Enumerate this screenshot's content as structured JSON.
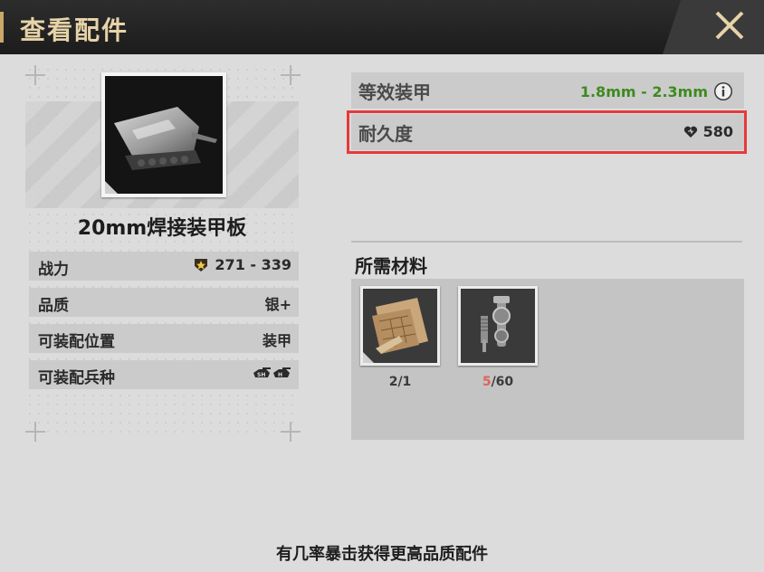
{
  "header": {
    "title": "查看配件",
    "close_icon": "close-x-icon"
  },
  "item": {
    "name": "20mm焊接装甲板"
  },
  "stats": [
    {
      "label": "战力",
      "value": "271 - 339",
      "icon": "power-star-icon"
    },
    {
      "label": "品质",
      "value": "银+"
    },
    {
      "label": "可装配位置",
      "value": "装甲"
    },
    {
      "label": "可装配兵种",
      "icon": "tank-class-icons"
    }
  ],
  "properties": {
    "armor": {
      "label": "等效装甲",
      "value": "1.8mm - 2.3mm",
      "info_icon": "info-icon"
    },
    "durability": {
      "label": "耐久度",
      "value": "580",
      "icon": "heart-icon"
    }
  },
  "materials": {
    "title": "所需材料",
    "items": [
      {
        "icon": "blueprint-icon",
        "have": "2",
        "need": "/1"
      },
      {
        "icon": "bolt-parts-icon",
        "have": "5",
        "need": "/60"
      }
    ]
  },
  "footer": {
    "text": "有几率暴击获得更高品质配件"
  },
  "colors": {
    "accent_gold": "#e6d3a8",
    "armor_value": "#3f8a1f",
    "highlight": "#e53a3a",
    "insufficient": "#e0645a"
  }
}
